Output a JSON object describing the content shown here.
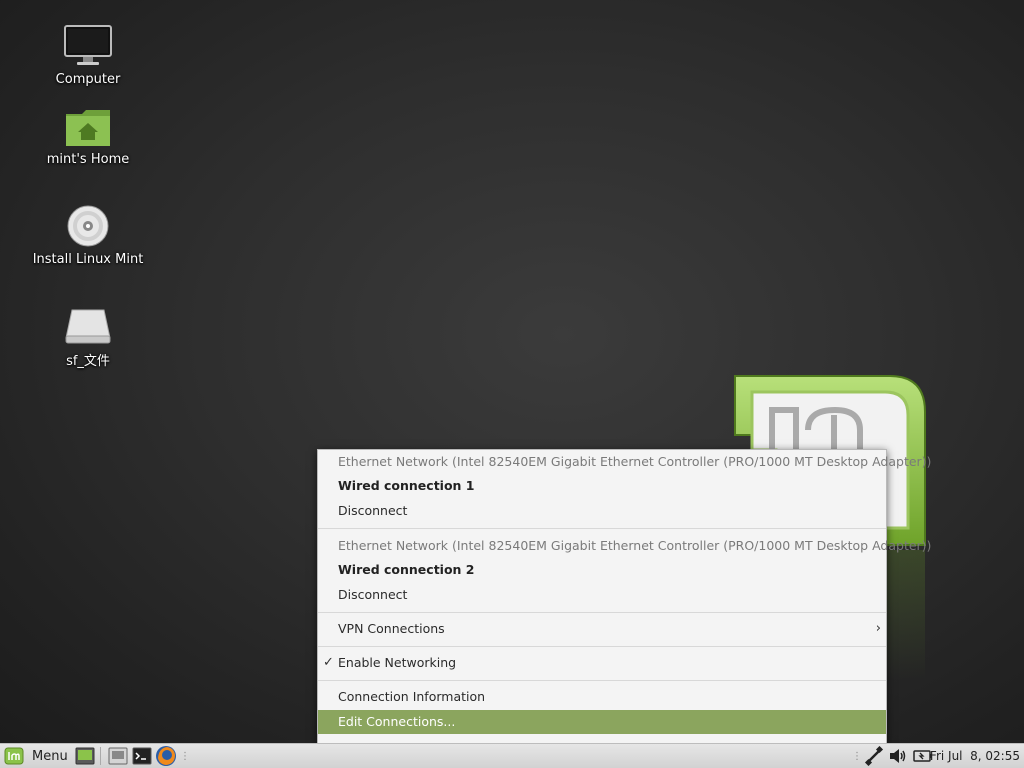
{
  "desktop": {
    "icons": [
      {
        "label": "Computer",
        "icon": "computer-icon"
      },
      {
        "label": "mint's Home",
        "icon": "home-folder-icon"
      },
      {
        "label": "Install Linux Mint",
        "icon": "disc-icon"
      },
      {
        "label": "sf_文件",
        "icon": "drive-icon"
      }
    ]
  },
  "network_menu": {
    "device1_header": "Ethernet Network (Intel 82540EM Gigabit Ethernet Controller (PRO/1000 MT Desktop Adapter))",
    "device1_connection": "Wired connection 1",
    "device1_disconnect": "Disconnect",
    "device2_header": "Ethernet Network (Intel 82540EM Gigabit Ethernet Controller (PRO/1000 MT Desktop Adapter))",
    "device2_connection": "Wired connection 2",
    "device2_disconnect": "Disconnect",
    "vpn": "VPN Connections",
    "enable_networking": "Enable Networking",
    "enable_networking_checked": true,
    "connection_info": "Connection Information",
    "edit_connections": "Edit Connections...",
    "highlighted_item": "Edit Connections...",
    "highlight_color": "#8ba55e"
  },
  "panel": {
    "menu_label": "Menu",
    "clock": "Fri Jul  8, 02:55"
  },
  "colors": {
    "mint_green": "#8bc34a",
    "panel_bg": "#dcdcdc"
  }
}
